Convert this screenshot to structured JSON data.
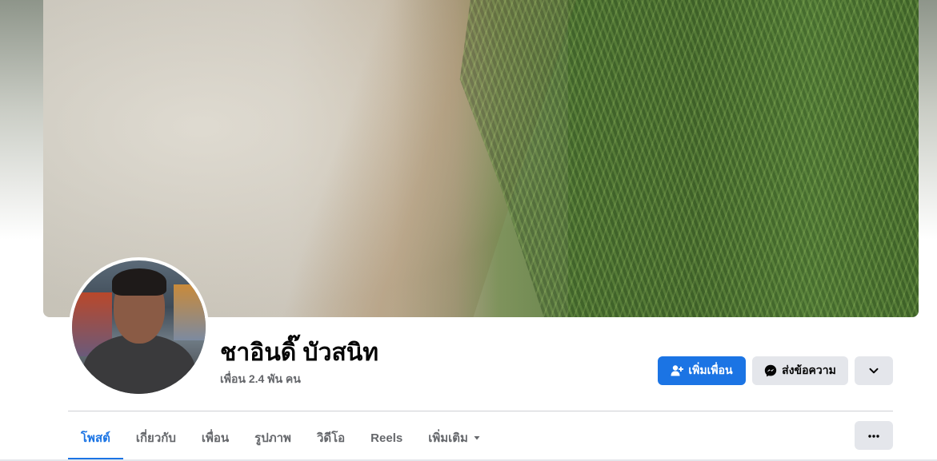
{
  "profile": {
    "name": "ชาอินดิ๊ บัวสนิท",
    "friends_count": "เพื่อน 2.4 พัน คน"
  },
  "actions": {
    "add_friend_label": "เพิ่มเพื่อน",
    "add_friend_icon": "user-plus-icon",
    "message_label": "ส่งข้อความ",
    "message_icon": "messenger-icon",
    "expand_icon": "chevron-down-icon"
  },
  "tabs": [
    {
      "label": "โพสต์",
      "active": true
    },
    {
      "label": "เกี่ยวกับ",
      "active": false
    },
    {
      "label": "เพื่อน",
      "active": false
    },
    {
      "label": "รูปภาพ",
      "active": false
    },
    {
      "label": "วิดีโอ",
      "active": false
    },
    {
      "label": "Reels",
      "active": false
    },
    {
      "label": "เพิ่มเติม",
      "active": false
    }
  ],
  "colors": {
    "accent": "#1b74e4",
    "button_secondary": "#e4e6eb",
    "text_primary": "#050505",
    "text_secondary": "#65676b"
  }
}
